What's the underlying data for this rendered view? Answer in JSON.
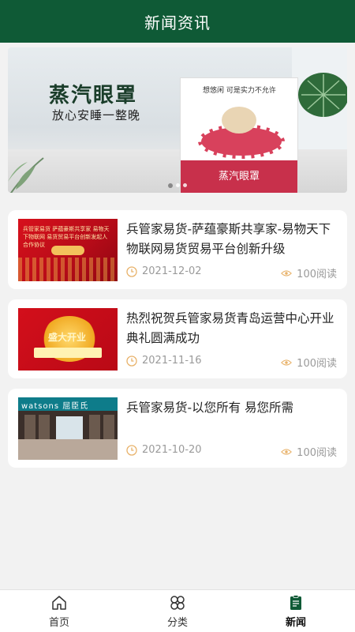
{
  "header": {
    "title": "新闻资讯"
  },
  "banner": {
    "headline": "蒸汽眼罩",
    "subline": "放心安睡一整晚",
    "box_tagline": "想悠闲 可是实力不允许",
    "box_title": "蒸汽眼罩",
    "slide_count": 3,
    "active_slide": 1
  },
  "news": [
    {
      "title": "兵管家易货-萨蕴豪斯共享家-易物天下物联网易货贸易平台创新升级",
      "date": "2021-12-02",
      "views": "100阅读",
      "thumb_caption": "兵管家易货 萨蕴豪斯共享家 易物天下物联网 易货贸易平台创新发起人合作协议"
    },
    {
      "title": "热烈祝贺兵管家易货青岛运营中心开业典礼圆满成功",
      "date": "2021-11-16",
      "views": "100阅读",
      "thumb_caption": "盛大开业"
    },
    {
      "title": "兵管家易货-以您所有 易您所需",
      "date": "2021-10-20",
      "views": "100阅读",
      "thumb_caption": "watsons 屈臣氏"
    }
  ],
  "tabbar": {
    "items": [
      {
        "label": "首页",
        "icon": "home-icon"
      },
      {
        "label": "分类",
        "icon": "category-icon"
      },
      {
        "label": "新闻",
        "icon": "news-icon",
        "active": true
      }
    ]
  },
  "colors": {
    "brand": "#0f5a36",
    "meta": "#9a9a9a",
    "icon_accent": "#e8b26a"
  }
}
